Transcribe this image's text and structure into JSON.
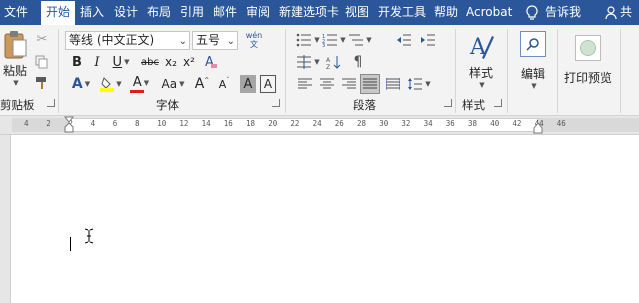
{
  "tabs": [
    {
      "label": "文件",
      "active": false
    },
    {
      "label": "开始",
      "active": true
    },
    {
      "label": "插入",
      "active": false
    },
    {
      "label": "设计",
      "active": false
    },
    {
      "label": "布局",
      "active": false
    },
    {
      "label": "引用",
      "active": false
    },
    {
      "label": "邮件",
      "active": false
    },
    {
      "label": "审阅",
      "active": false
    },
    {
      "label": "新建选项卡",
      "active": false
    },
    {
      "label": "视图",
      "active": false
    },
    {
      "label": "开发工具",
      "active": false
    },
    {
      "label": "帮助",
      "active": false
    },
    {
      "label": "Acrobat",
      "active": false
    }
  ],
  "tell_me": "告诉我",
  "share": "共",
  "clipboard": {
    "paste_label": "粘贴",
    "group_label": "剪贴板"
  },
  "font": {
    "font_name": "等线 (中文正文)",
    "font_size": "五号",
    "wen_label": "wén 文",
    "group_label": "字体",
    "bold": "B",
    "italic": "I",
    "underline": "U",
    "strike": "abc",
    "subscript": "x₂",
    "superscript": "x²",
    "clear_format": "A",
    "font_color": "A",
    "case": "Aa",
    "grow": "A",
    "shrink": "A",
    "char_border": "A",
    "char_shade": "A"
  },
  "paragraph": {
    "group_label": "段落"
  },
  "styles": {
    "label": "样式",
    "group_label": "样式"
  },
  "editing": {
    "label": "编辑"
  },
  "print_preview": {
    "label": "打印预览"
  },
  "ruler_numbers": [
    "4",
    "2",
    "2",
    "4",
    "6",
    "8",
    "10",
    "12",
    "14",
    "16",
    "18",
    "20",
    "22",
    "24",
    "26",
    "28",
    "30",
    "32",
    "34",
    "36",
    "38",
    "40",
    "42",
    "44",
    "46"
  ],
  "colors": {
    "accent": "#2b579a",
    "ribbon": "#f3f3f3",
    "highlight": "#ffff00",
    "font_color": "#e21b1b",
    "styles_accent": "#2b579a"
  }
}
